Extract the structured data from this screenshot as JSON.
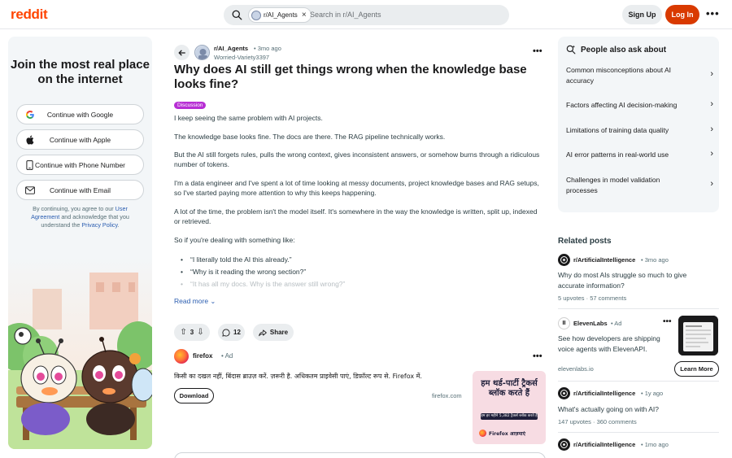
{
  "header": {
    "logo": "reddit",
    "search_chip": "r/AI_Agents",
    "search_placeholder": "Search in r/AI_Agents",
    "signup_label": "Sign Up",
    "login_label": "Log In",
    "accent_color": "#d93a00"
  },
  "left_panel": {
    "title": "Join the most real place on the internet",
    "buttons": [
      {
        "label": "Continue with Google",
        "icon": "google-icon"
      },
      {
        "label": "Continue with Apple",
        "icon": "apple-icon"
      },
      {
        "label": "Continue with Phone Number",
        "icon": "phone-icon"
      },
      {
        "label": "Continue with Email",
        "icon": "mail-icon"
      }
    ],
    "legal_prefix": "By continuing, you agree to our",
    "legal_link_1": "User Agreement",
    "legal_middle": "and acknowledge that you understand the",
    "legal_link_2": "Privacy Policy",
    "legal_suffix": "."
  },
  "post": {
    "subreddit": "r/AI_Agents",
    "time": "• 3mo ago",
    "author": "Worried-Variety3397",
    "title": "Why does AI still get things wrong when the knowledge base looks fine?",
    "flair": "Discussion",
    "paragraphs": [
      "I keep seeing the same problem with AI projects.",
      "The knowledge base looks fine. The docs are there. The RAG pipeline technically works.",
      "But the AI still forgets rules, pulls the wrong context, gives inconsistent answers, or somehow burns through a ridiculous number of tokens.",
      "I'm a data engineer and I've spent a lot of time looking at messy documents, project knowledge bases and RAG setups, so I've started paying more attention to why this keeps happening.",
      "A lot of the time, the problem isn't the model itself. It's somewhere in the way the knowledge is written, split up, indexed or retrieved.",
      "So if you're dealing with something like:"
    ],
    "bullets": [
      "“I literally told the AI this already.”",
      "“Why is it reading the wrong section?”",
      "“It has all my docs. Why is the answer still wrong?”"
    ],
    "read_more": "Read more",
    "votes": "3",
    "comments": "12",
    "share": "Share"
  },
  "ad": {
    "name": "firefox",
    "tag": "• Ad",
    "text": "किसी का दखल नहीं, बिंदास ब्राउज़ करें. ज़रूरी है. अधिकतम प्राइवेसी पाएं, डिफ़ॉल्ट रूप से. Firefox में.",
    "cta": "Download",
    "domain": "firefox.com",
    "image_headline": "हम थर्ड-पार्टी ट्रैकर्स ब्लॉक करते हैं",
    "image_sub": "हम हर महीने 5,382 ट्रैकर्स ब्लॉक करते हैं",
    "image_brand": "Firefox आज़माएं"
  },
  "people_also_ask": {
    "title": "People also ask about",
    "items": [
      "Common misconceptions about AI accuracy",
      "Factors affecting AI decision-making",
      "Limitations of training data quality",
      "AI error patterns in real-world use",
      "Challenges in model validation processes"
    ]
  },
  "related": {
    "title": "Related posts",
    "posts": [
      {
        "subreddit": "r/ArtificialIntelligence",
        "time": "• 3mo ago",
        "title": "Why do most AIs struggle so much to give accurate information?",
        "upvotes": "5 upvotes",
        "comments": "57 comments"
      },
      {
        "subreddit": "ElevenLabs",
        "time": "• Ad",
        "title": "See how developers are shipping voice agents with ElevenAPI.",
        "domain": "elevenlabs.io",
        "cta": "Learn More"
      },
      {
        "subreddit": "r/ArtificialIntelligence",
        "time": "• 1y ago",
        "title": "What's actually going on with AI?",
        "upvotes": "147 upvotes",
        "comments": "360 comments"
      },
      {
        "subreddit": "r/ArtificialIntelligence",
        "time": "• 1mo ago"
      }
    ]
  }
}
